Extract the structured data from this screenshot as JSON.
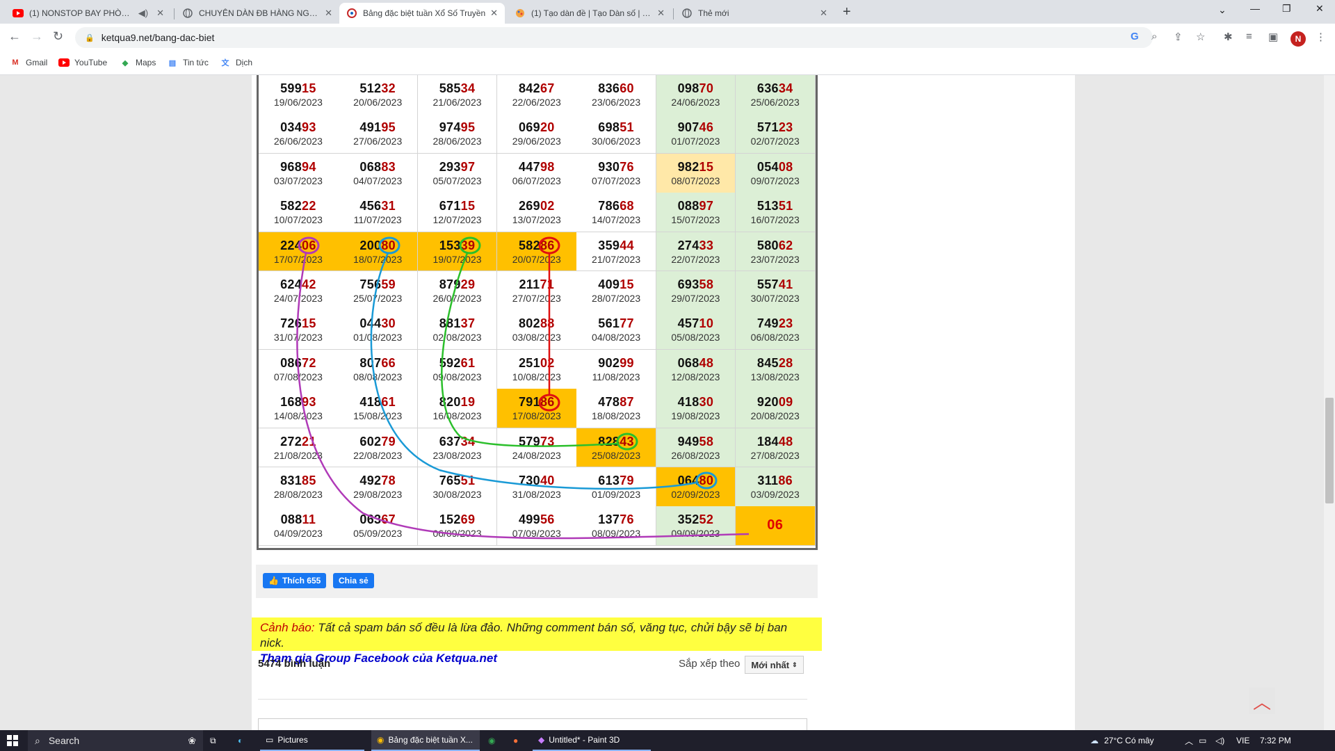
{
  "browser": {
    "tabs": [
      {
        "title": "(1) NONSTOP BAY PHÒNG 2(",
        "icon": "youtube-icon"
      },
      {
        "title": "CHUYÊN DÀN ĐB HÀNG NGÀY X",
        "icon": "globe-icon"
      },
      {
        "title": "Bảng đặc biệt tuần Xổ Số Truyền",
        "icon": "ketqua-icon"
      },
      {
        "title": "(1) Tạo dàn đề | Tạo Dàn số | Tạo",
        "icon": "paint-icon"
      },
      {
        "title": "Thẻ mới",
        "icon": "globe-icon"
      }
    ],
    "url": "ketqua9.net/bang-dac-biet",
    "profile_initial": "N",
    "bookmarks": [
      "Gmail",
      "YouTube",
      "Maps",
      "Tin tức",
      "Dịch"
    ]
  },
  "table": {
    "columns": 7,
    "rows": [
      [
        [
          "599",
          "15",
          "19/06/2023"
        ],
        [
          "512",
          "32",
          "20/06/2023"
        ],
        [
          "585",
          "34",
          "21/06/2023"
        ],
        [
          "842",
          "67",
          "22/06/2023"
        ],
        [
          "836",
          "60",
          "23/06/2023"
        ],
        [
          "098",
          "70",
          "24/06/2023"
        ],
        [
          "636",
          "34",
          "25/06/2023"
        ]
      ],
      [
        [
          "034",
          "93",
          "26/06/2023"
        ],
        [
          "491",
          "95",
          "27/06/2023"
        ],
        [
          "974",
          "95",
          "28/06/2023"
        ],
        [
          "069",
          "20",
          "29/06/2023"
        ],
        [
          "698",
          "51",
          "30/06/2023"
        ],
        [
          "907",
          "46",
          "01/07/2023"
        ],
        [
          "571",
          "23",
          "02/07/2023"
        ]
      ],
      [
        [
          "968",
          "94",
          "03/07/2023"
        ],
        [
          "068",
          "83",
          "04/07/2023"
        ],
        [
          "293",
          "97",
          "05/07/2023"
        ],
        [
          "447",
          "98",
          "06/07/2023"
        ],
        [
          "930",
          "76",
          "07/07/2023"
        ],
        [
          "982",
          "15",
          "08/07/2023"
        ],
        [
          "054",
          "08",
          "09/07/2023"
        ]
      ],
      [
        [
          "582",
          "22",
          "10/07/2023"
        ],
        [
          "456",
          "31",
          "11/07/2023"
        ],
        [
          "671",
          "15",
          "12/07/2023"
        ],
        [
          "269",
          "02",
          "13/07/2023"
        ],
        [
          "786",
          "68",
          "14/07/2023"
        ],
        [
          "088",
          "97",
          "15/07/2023"
        ],
        [
          "513",
          "51",
          "16/07/2023"
        ]
      ],
      [
        [
          "224",
          "06",
          "17/07/2023"
        ],
        [
          "200",
          "80",
          "18/07/2023"
        ],
        [
          "153",
          "39",
          "19/07/2023"
        ],
        [
          "582",
          "86",
          "20/07/2023"
        ],
        [
          "359",
          "44",
          "21/07/2023"
        ],
        [
          "274",
          "33",
          "22/07/2023"
        ],
        [
          "580",
          "62",
          "23/07/2023"
        ]
      ],
      [
        [
          "624",
          "42",
          "24/07/2023"
        ],
        [
          "756",
          "59",
          "25/07/2023"
        ],
        [
          "879",
          "29",
          "26/07/2023"
        ],
        [
          "211",
          "71",
          "27/07/2023"
        ],
        [
          "409",
          "15",
          "28/07/2023"
        ],
        [
          "693",
          "58",
          "29/07/2023"
        ],
        [
          "557",
          "41",
          "30/07/2023"
        ]
      ],
      [
        [
          "726",
          "15",
          "31/07/2023"
        ],
        [
          "044",
          "30",
          "01/08/2023"
        ],
        [
          "881",
          "37",
          "02/08/2023"
        ],
        [
          "802",
          "88",
          "03/08/2023"
        ],
        [
          "561",
          "77",
          "04/08/2023"
        ],
        [
          "457",
          "10",
          "05/08/2023"
        ],
        [
          "749",
          "23",
          "06/08/2023"
        ]
      ],
      [
        [
          "086",
          "72",
          "07/08/2023"
        ],
        [
          "807",
          "66",
          "08/08/2023"
        ],
        [
          "592",
          "61",
          "09/08/2023"
        ],
        [
          "251",
          "02",
          "10/08/2023"
        ],
        [
          "902",
          "99",
          "11/08/2023"
        ],
        [
          "068",
          "48",
          "12/08/2023"
        ],
        [
          "845",
          "28",
          "13/08/2023"
        ]
      ],
      [
        [
          "168",
          "93",
          "14/08/2023"
        ],
        [
          "418",
          "61",
          "15/08/2023"
        ],
        [
          "820",
          "19",
          "16/08/2023"
        ],
        [
          "791",
          "86",
          "17/08/2023"
        ],
        [
          "478",
          "87",
          "18/08/2023"
        ],
        [
          "418",
          "30",
          "19/08/2023"
        ],
        [
          "920",
          "09",
          "20/08/2023"
        ]
      ],
      [
        [
          "272",
          "21",
          "21/08/2023"
        ],
        [
          "602",
          "79",
          "22/08/2023"
        ],
        [
          "637",
          "34",
          "23/08/2023"
        ],
        [
          "579",
          "73",
          "24/08/2023"
        ],
        [
          "828",
          "43",
          "25/08/2023"
        ],
        [
          "949",
          "58",
          "26/08/2023"
        ],
        [
          "184",
          "48",
          "27/08/2023"
        ]
      ],
      [
        [
          "831",
          "85",
          "28/08/2023"
        ],
        [
          "492",
          "78",
          "29/08/2023"
        ],
        [
          "765",
          "51",
          "30/08/2023"
        ],
        [
          "730",
          "40",
          "31/08/2023"
        ],
        [
          "613",
          "79",
          "01/09/2023"
        ],
        [
          "064",
          "80",
          "02/09/2023"
        ],
        [
          "311",
          "86",
          "03/09/2023"
        ]
      ],
      [
        [
          "088",
          "11",
          "04/09/2023"
        ],
        [
          "063",
          "67",
          "05/09/2023"
        ],
        [
          "152",
          "69",
          "06/09/2023"
        ],
        [
          "499",
          "56",
          "07/09/2023"
        ],
        [
          "137",
          "76",
          "08/09/2023"
        ],
        [
          "352",
          "52",
          "09/09/2023"
        ],
        [
          "",
          "06",
          ""
        ]
      ]
    ],
    "highlighted": [
      [
        4,
        0
      ],
      [
        4,
        1
      ],
      [
        4,
        2
      ],
      [
        4,
        3
      ],
      [
        8,
        3
      ],
      [
        9,
        4
      ],
      [
        10,
        5
      ],
      [
        11,
        6
      ]
    ],
    "light_highlighted": [
      [
        2,
        5
      ]
    ],
    "annotation_colors": {
      "purple": "#b03ab8",
      "blue": "#1a9ad6",
      "green": "#2bbf2b",
      "red": "#e01010"
    }
  },
  "share": {
    "like_label": "Thích 655",
    "share_label": "Chia sẻ"
  },
  "warning": {
    "label": "Cảnh báo:",
    "text": "Tất cả spam bán số đều là lừa đảo. Những comment bán số, văng tục, chửi bậy sẽ bị ban nick.",
    "link": "Tham gia Group Facebook của Ketqua.net"
  },
  "comments": {
    "count": "5474 bình luận",
    "sort_label": "Sắp xếp theo",
    "sort_value": "Mới nhất"
  },
  "taskbar": {
    "search": "Search",
    "apps": [
      "Pictures",
      "Bảng đặc biệt tuần X...",
      "Untitled* - Paint 3D"
    ],
    "weather": "27°C  Có mây",
    "lang": "VIE",
    "time": "7:32 PM"
  }
}
